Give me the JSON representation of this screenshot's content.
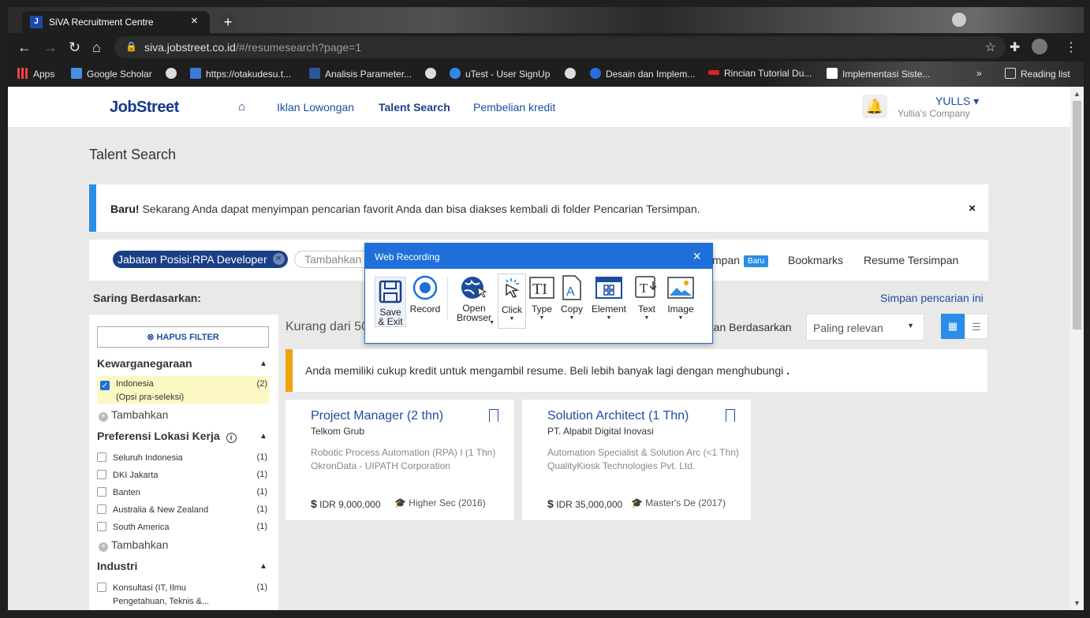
{
  "browser": {
    "tab_title": "SiVA Recruitment Centre",
    "tab_favicon": "J",
    "url_host": "siva.jobstreet.co.id",
    "url_path": "/#/resumesearch?page=1",
    "bookmarks": [
      {
        "label": "Apps",
        "icon": "apps-grid-icon",
        "color": "#e44"
      },
      {
        "label": "Google Scholar",
        "icon": "scholar-cap-icon",
        "color": "#4a90e2"
      },
      {
        "label": "",
        "icon": "globe-icon",
        "color": "#ddd"
      },
      {
        "label": "https://otakudesu.t...",
        "icon": "page-icon",
        "color": "#3b7bd6"
      },
      {
        "label": "Analisis Parameter...",
        "icon": "doc-d-icon",
        "color": "#2b5797"
      },
      {
        "label": "",
        "icon": "globe-icon",
        "color": "#ddd"
      },
      {
        "label": "uTest - User SignUp",
        "icon": "utest-icon",
        "color": "#2f8ae5"
      },
      {
        "label": "",
        "icon": "globe-icon",
        "color": "#ddd"
      },
      {
        "label": "Desain dan Implem...",
        "icon": "circle-e-icon",
        "color": "#2d6cdf"
      },
      {
        "label": "Rincian Tutorial Du...",
        "icon": "dw-logo-icon",
        "color": "#d22"
      },
      {
        "label": "Implementasi Siste...",
        "icon": "pkp-icon",
        "color": "#fff"
      }
    ],
    "reading_list": "Reading list",
    "more": "»"
  },
  "header": {
    "logo": "JobStreet",
    "nav": [
      "Iklan Lowongan",
      "Talent Search",
      "Pembelian kredit"
    ],
    "user_name": "YULLS ▾",
    "company": "Yullia's Company"
  },
  "page": {
    "title": "Talent Search",
    "banner_bold": "Baru!",
    "banner_text": " Sekarang Anda dapat menyimpan pencarian favorit Anda dan bisa diakses kembali di folder Pencarian Tersimpan.",
    "banner_close": "×",
    "search_chip": "Jabatan Posisi:RPA Developer",
    "search_add_placeholder": "Tambahkan",
    "search_links": {
      "pencarian": "mpan",
      "baru": "Baru",
      "bookmarks": "Bookmarks",
      "resume": "Resume Tersimpan"
    },
    "saring": "Saring Berdasarkan:",
    "simpan": "Simpan pencarian ini"
  },
  "filters": {
    "hapus": "HAPUS FILTER",
    "kewarganegaraan": {
      "title": "Kewarganegaraan",
      "options": [
        {
          "label": "Indonesia",
          "sub": "(Opsi pra-seleksi)",
          "count": "(2)",
          "checked": true
        }
      ],
      "add": "Tambahkan"
    },
    "lokasi": {
      "title": "Preferensi Lokasi Kerja",
      "options": [
        {
          "label": "Seluruh Indonesia",
          "count": "(1)"
        },
        {
          "label": "DKI Jakarta",
          "count": "(1)"
        },
        {
          "label": "Banten",
          "count": "(1)"
        },
        {
          "label": "Australia & New Zealand",
          "count": "(1)"
        },
        {
          "label": "South America",
          "count": "(1)"
        }
      ],
      "add": "Tambahkan"
    },
    "industri": {
      "title": "Industri",
      "options": [
        {
          "label": "Konsultasi (IT, Ilmu",
          "label2": "Pengetahuan, Teknis &...",
          "count": "(1)"
        }
      ]
    }
  },
  "results": {
    "count_text": "Kurang dari 50",
    "sort_label": "utkan Berdasarkan",
    "sort_value": "Paling relevan",
    "kredit_msg": "Anda memiliki cukup kredit untuk mengambil resume. Beli lebih banyak lagi dengan menghubungi ",
    "kredit_dot": ".",
    "cards": [
      {
        "title": "Project Manager (2 thn)",
        "company": "Telkom Grub",
        "prev_role": "Robotic Process Automation (RPA) I",
        "prev_dur": "(1 Thn)",
        "prev_company": "OkronData - UIPATH Corporation",
        "salary": "IDR 9,000,000",
        "education": "Higher Sec",
        "year": "(2016)"
      },
      {
        "title": "Solution Architect (1 Thn)",
        "company": "PT. Alpabit Digital Inovasi",
        "prev_role": "Automation Specialist & Solution Arc",
        "prev_dur": "(<1 Thn)",
        "prev_company": "QualityKiosk Technologies Pvt. Ltd.",
        "salary": "IDR 35,000,000",
        "education": "Master's De",
        "year": "(2017)"
      }
    ]
  },
  "web_recording": {
    "title": "Web Recording",
    "close": "×",
    "tools": [
      {
        "label": "Save\n& Exit",
        "icon": "save-icon"
      },
      {
        "label": "Record",
        "icon": "record-icon"
      },
      {
        "label": "Open\nBrowser",
        "icon": "globe-cursor-icon"
      },
      {
        "label": "Click",
        "icon": "click-cursor-icon"
      },
      {
        "label": "Type",
        "icon": "type-text-icon"
      },
      {
        "label": "Copy",
        "icon": "copy-doc-icon"
      },
      {
        "label": "Element",
        "icon": "element-grid-icon"
      },
      {
        "label": "Text",
        "icon": "text-extract-icon"
      },
      {
        "label": "Image",
        "icon": "image-icon"
      }
    ]
  }
}
